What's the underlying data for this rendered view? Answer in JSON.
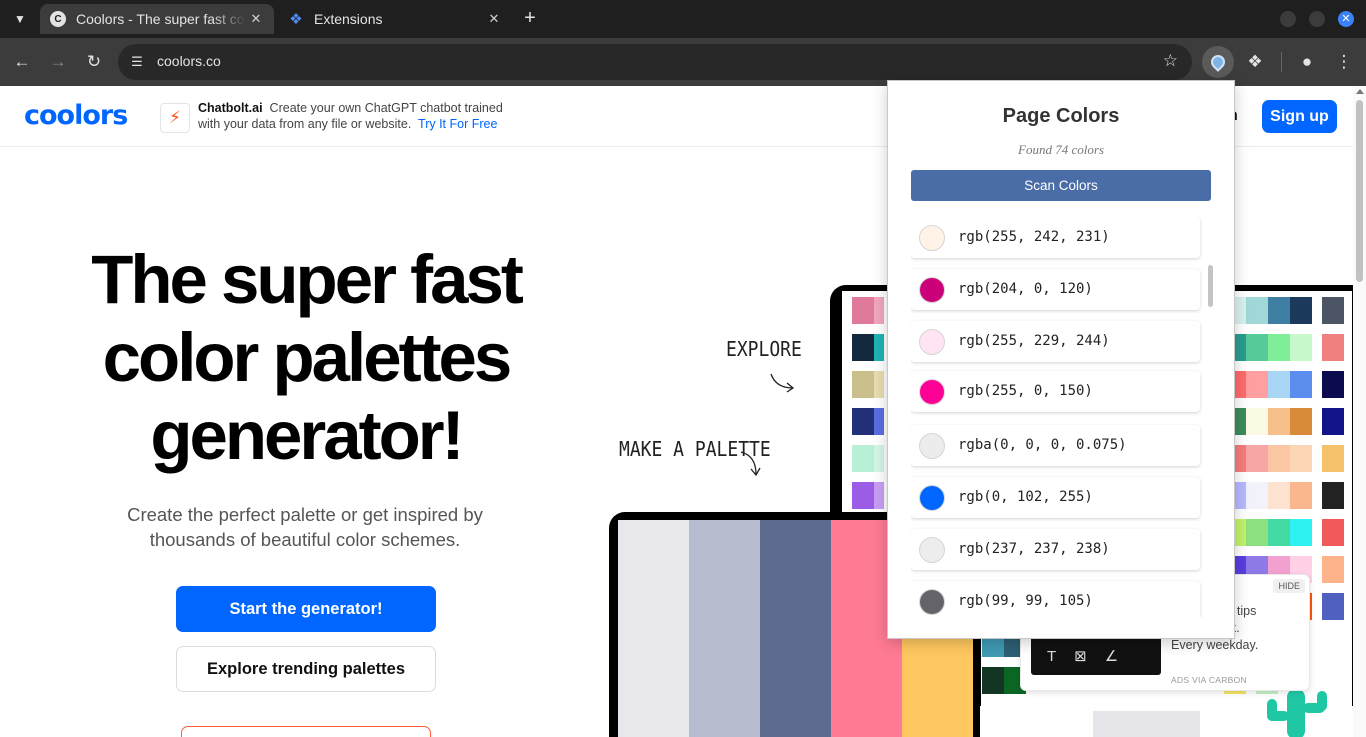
{
  "browser": {
    "tabs": [
      {
        "title": "Coolors - The super fast color palettes generator!",
        "active": true
      },
      {
        "title": "Extensions",
        "active": false
      }
    ],
    "url": "coolors.co"
  },
  "site": {
    "logo": "coolors",
    "ad": {
      "brand": "Chatbolt.ai",
      "line1": "Create your own ChatGPT chatbot trained",
      "line2": "with your data from any file or website.",
      "cta": "Try It For Free"
    },
    "login_fragment": "n",
    "signup": "Sign up",
    "hero": {
      "title_line1": "The super fast",
      "title_line2": "color palettes",
      "title_line3": "generator!",
      "subtitle": "Create the perfect palette or get inspired by thousands of beautiful color schemes.",
      "primary_button": "Start the generator!",
      "secondary_button": "Explore trending palettes"
    },
    "illustration": {
      "explore_label": "EXPLORE",
      "make_label": "MAKE A PALETTE",
      "front_palette": [
        "#e8e8ec",
        "#b8bccf",
        "#5c6b8f",
        "#ff7a94",
        "#ffc75f"
      ]
    },
    "carbon_ad": {
      "hide": "HIDE",
      "text_frag1": "nt tips",
      "text_frag2": "ox.",
      "text_frag3": "Every weekday.",
      "via": "ADS VIA CARBON"
    }
  },
  "popup": {
    "title": "Page Colors",
    "found": "Found 74 colors",
    "scan_button": "Scan Colors",
    "colors": [
      {
        "label": "rgb(255, 242, 231)",
        "hex": "#fff2e7"
      },
      {
        "label": "rgb(204, 0, 120)",
        "hex": "#cc0078"
      },
      {
        "label": "rgb(255, 229, 244)",
        "hex": "#ffe5f4"
      },
      {
        "label": "rgb(255, 0, 150)",
        "hex": "#ff0096"
      },
      {
        "label": "rgba(0, 0, 0, 0.075)",
        "hex": "#ececec"
      },
      {
        "label": "rgb(0, 102, 255)",
        "hex": "#0066ff"
      },
      {
        "label": "rgb(237, 237, 238)",
        "hex": "#ededee"
      },
      {
        "label": "rgb(99, 99, 105)",
        "hex": "#636369"
      }
    ]
  }
}
